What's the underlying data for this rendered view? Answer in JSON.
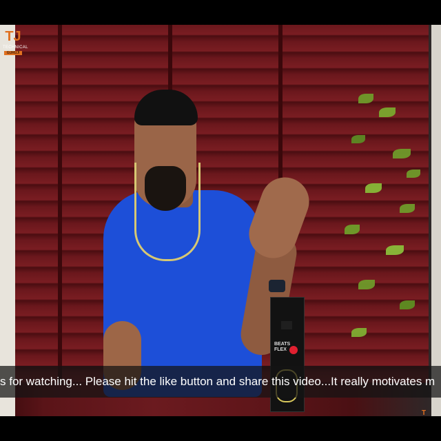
{
  "video": {
    "channel_logo": {
      "mark": "TJ",
      "text": "TECHNICAL",
      "sub": "GURUJI"
    },
    "product_box": {
      "label_line1": "BEATS",
      "label_line2": "FLEX"
    },
    "subtitle": "s for watching... Please hit the like button and share this video...It really motivates m"
  },
  "colors": {
    "blinds": "#6a171c",
    "shirt": "#1d4fd8",
    "accent_logo": "#e07020",
    "earphones": "#d7c873",
    "box_logo": "#e02030"
  },
  "icons": {
    "channel_logo": "channel-logo-icon",
    "corner_logo": "corner-logo-icon"
  }
}
